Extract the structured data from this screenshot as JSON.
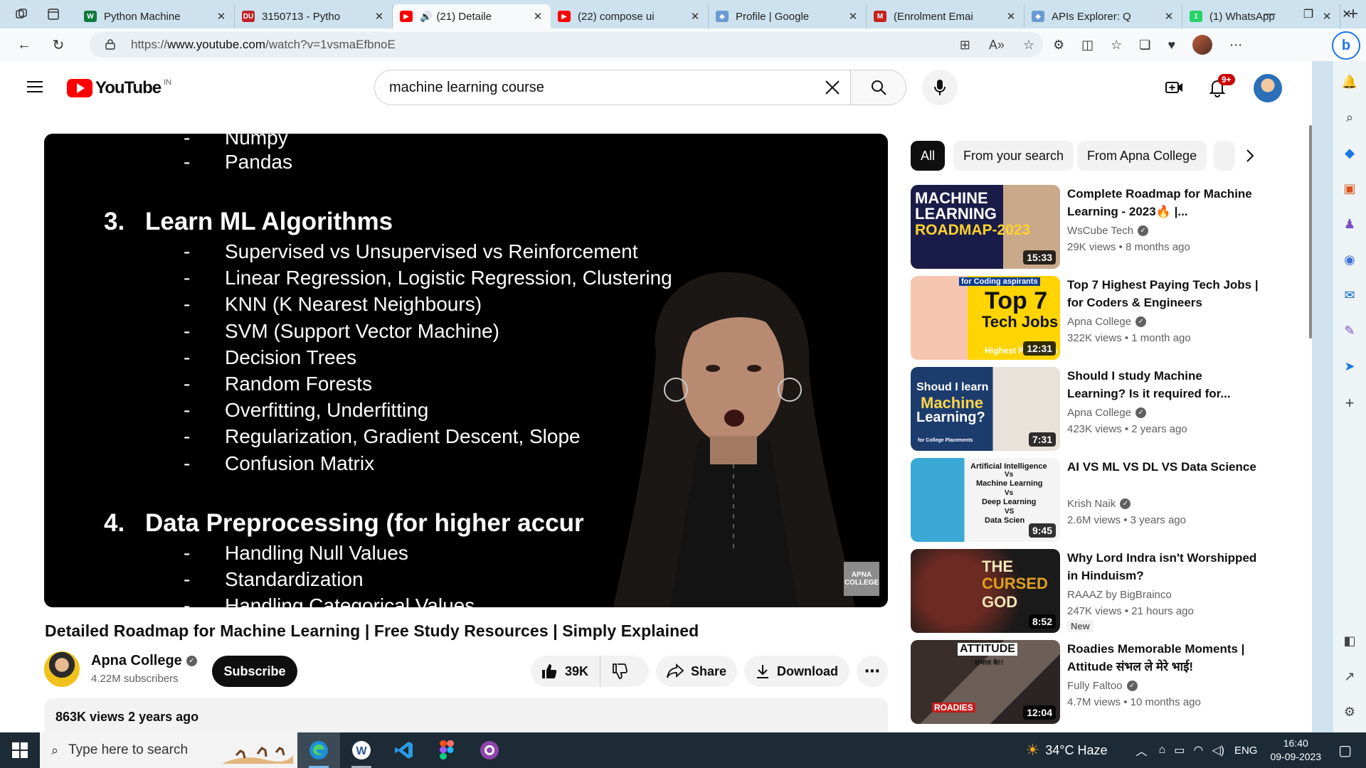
{
  "browser": {
    "tabs": [
      {
        "label": "Python Machine",
        "favicon": "W",
        "color": "#0f7a3d"
      },
      {
        "label": "3150713 - Pytho",
        "favicon": "DU",
        "color": "#c0232a"
      },
      {
        "label": "(21) Detaile",
        "favicon": "yt",
        "color": "#ff0000",
        "active": true
      },
      {
        "label": "(22) compose ui",
        "favicon": "yt",
        "color": "#ff0000"
      },
      {
        "label": "Profile | Google",
        "favicon": "g",
        "color": "#6b9bd2"
      },
      {
        "label": "(Enrolment Emai",
        "favicon": "M",
        "color": "#c5221f"
      },
      {
        "label": "APIs Explorer: Q",
        "favicon": "g",
        "color": "#6b9bd2"
      },
      {
        "label": "(1) WhatsApp",
        "favicon": "1",
        "color": "#25d366"
      }
    ],
    "url_prefix": "https://",
    "url_host": "www.youtube.com",
    "url_path": "/watch?v=1vsmaEfbnoE"
  },
  "yt": {
    "logo_text": "YouTube",
    "country": "IN",
    "search_query": "machine learning course",
    "notif_badge": "9+"
  },
  "video": {
    "slide": {
      "top_items": [
        "Numpy",
        "Pandas"
      ],
      "section3_num": "3.",
      "section3_title": "Learn ML Algorithms",
      "section3_items": [
        "Supervised vs Unsupervised vs Reinforcement",
        "Linear Regression, Logistic Regression, Clustering",
        "KNN (K Nearest Neighbours)",
        "SVM (Support Vector Machine)",
        "Decision Trees",
        "Random Forests",
        "Overfitting, Underfitting",
        "Regularization, Gradient Descent, Slope",
        "Confusion Matrix"
      ],
      "section4_num": "4.",
      "section4_title": "Data Preprocessing (for higher accur",
      "section4_items": [
        "Handling Null Values",
        "Standardization",
        "Handling Categorical Values"
      ],
      "watermark": "APNA COLLEGE"
    },
    "title": "Detailed Roadmap for Machine Learning | Free Study Resources | Simply Explained",
    "channel": "Apna College",
    "subscribers": "4.22M subscribers",
    "subscribe_label": "Subscribe",
    "likes": "39K",
    "share_label": "Share",
    "download_label": "Download",
    "views_date": "863K views  2 years ago"
  },
  "chips": [
    "All",
    "From your search",
    "From Apna College"
  ],
  "recs": [
    {
      "title": "Complete Roadmap for Machine Learning - 2023🔥 |...",
      "channel": "WsCube Tech",
      "meta": "29K views  •  8 months ago",
      "duration": "15:33",
      "verified": true,
      "thumb_text": [
        "MACHINE",
        "LEARNING",
        "ROADMAP-2023"
      ]
    },
    {
      "title": "Top 7 Highest Paying Tech Jobs | for Coders & Engineers",
      "channel": "Apna College",
      "meta": "322K views  •  1 month ago",
      "duration": "12:31",
      "verified": true,
      "thumb_text": [
        "for Coding aspirants",
        "Top 7",
        "Tech Jobs",
        "Highest Packages"
      ]
    },
    {
      "title": "Should I study Machine Learning? Is it required for...",
      "channel": "Apna College",
      "meta": "423K views  •  2 years ago",
      "duration": "7:31",
      "verified": true,
      "thumb_text": [
        "Shoud I learn",
        "Machine",
        "Learning?",
        "for College Placements"
      ]
    },
    {
      "title": "AI VS ML VS DL VS Data Science",
      "channel": "Krish Naik",
      "meta": "2.6M views  •  3 years ago",
      "duration": "9:45",
      "verified": true,
      "thumb_text": [
        "Artificial Intelligence",
        "Vs",
        "Machine Learning",
        "Vs",
        "Deep Learning",
        "VS",
        "Data Scien"
      ]
    },
    {
      "title": "Why Lord Indra isn't Worshipped in Hinduism?",
      "channel": "RAAAZ by BigBrainco",
      "meta": "247K views  •  21 hours ago",
      "duration": "8:52",
      "verified": false,
      "new": "New",
      "thumb_text": [
        "THE",
        "CURSED",
        "GOD"
      ]
    },
    {
      "title": "Roadies Memorable Moments | Attitude संभल ले मेरे भाई!",
      "channel": "Fully Faltoo",
      "meta": "4.7M views  •  10 months ago",
      "duration": "12:04",
      "verified": true,
      "thumb_text": [
        "ATTITUDE",
        "संभाल के!!",
        "ROADIES"
      ]
    }
  ],
  "taskbar": {
    "search_placeholder": "Type here to search",
    "weather": "34°C  Haze",
    "lang": "ENG",
    "time": "16:40",
    "date": "09-09-2023"
  }
}
